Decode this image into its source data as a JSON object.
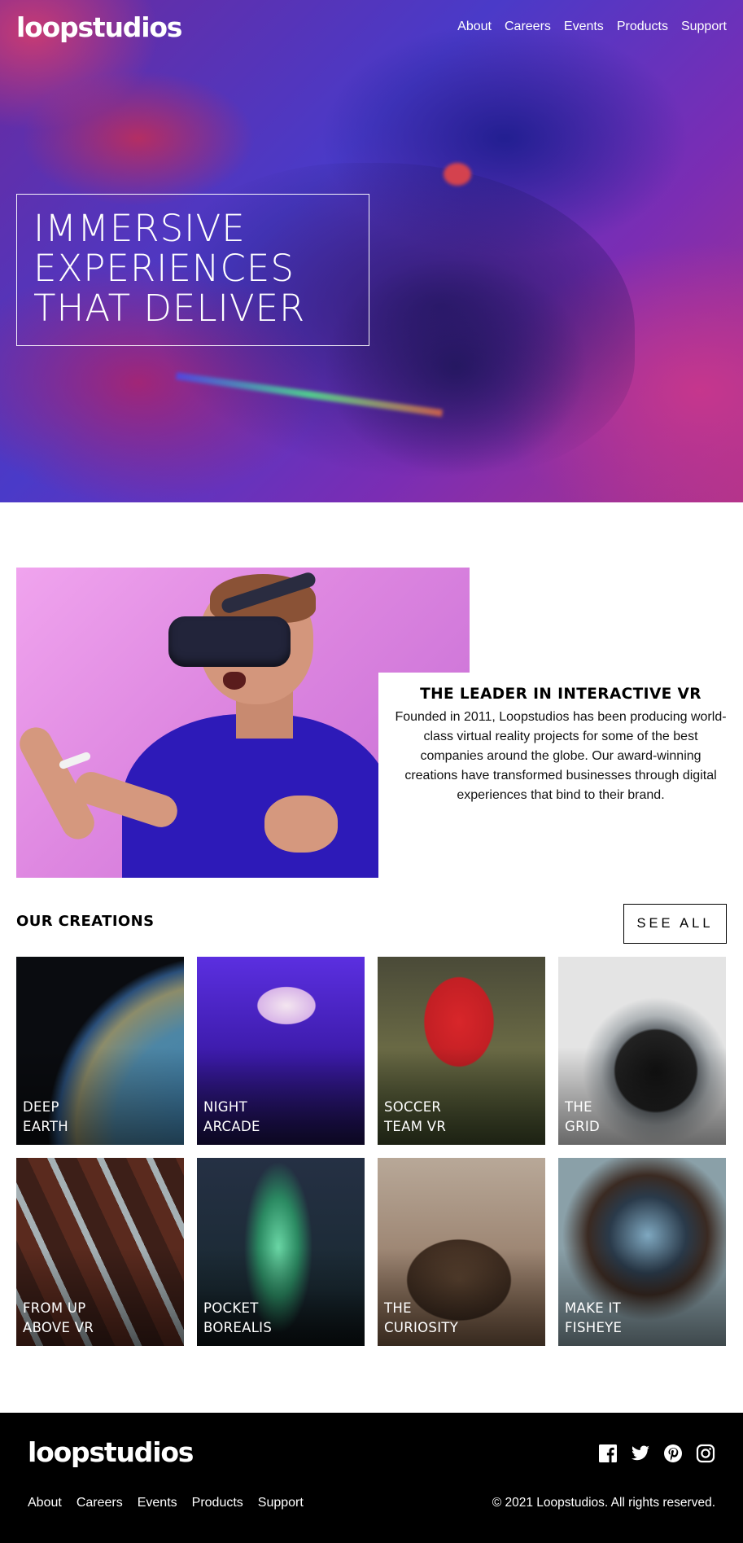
{
  "header": {
    "logo": "loopstudios",
    "nav": [
      "About",
      "Careers",
      "Events",
      "Products",
      "Support"
    ]
  },
  "hero": {
    "headline_lines": [
      "IMMERSIVE",
      "EXPERIENCES",
      "THAT DELIVER"
    ]
  },
  "intro": {
    "title": "THE LEADER IN INTERACTIVE VR",
    "text": "Founded in 2011, Loopstudios has been producing world-class virtual reality projects for some of the best companies around the globe. Our award-winning creations have transformed businesses through digital experiences that bind to their brand."
  },
  "creations": {
    "title": "OUR CREATIONS",
    "see_all_label": "SEE ALL",
    "items": [
      {
        "line1": "Deep",
        "line2": "Earth"
      },
      {
        "line1": "Night",
        "line2": "Arcade"
      },
      {
        "line1": "Soccer",
        "line2": "Team VR"
      },
      {
        "line1": "The",
        "line2": "Grid"
      },
      {
        "line1": "From up",
        "line2": "above VR"
      },
      {
        "line1": "Pocket",
        "line2": "Borealis"
      },
      {
        "line1": "The",
        "line2": "Curiosity"
      },
      {
        "line1": "Make it",
        "line2": "Fisheye"
      }
    ]
  },
  "footer": {
    "logo": "loopstudios",
    "nav": [
      "About",
      "Careers",
      "Events",
      "Products",
      "Support"
    ],
    "social_icons": [
      "facebook-icon",
      "twitter-icon",
      "pinterest-icon",
      "instagram-icon"
    ],
    "copyright": "© 2021 Loopstudios. All rights reserved."
  },
  "colors": {
    "background": "#ffffff",
    "text": "#000000",
    "footer_background": "#000000",
    "hero_purple": "#4a3ac8",
    "hero_magenta": "#b0338a"
  }
}
